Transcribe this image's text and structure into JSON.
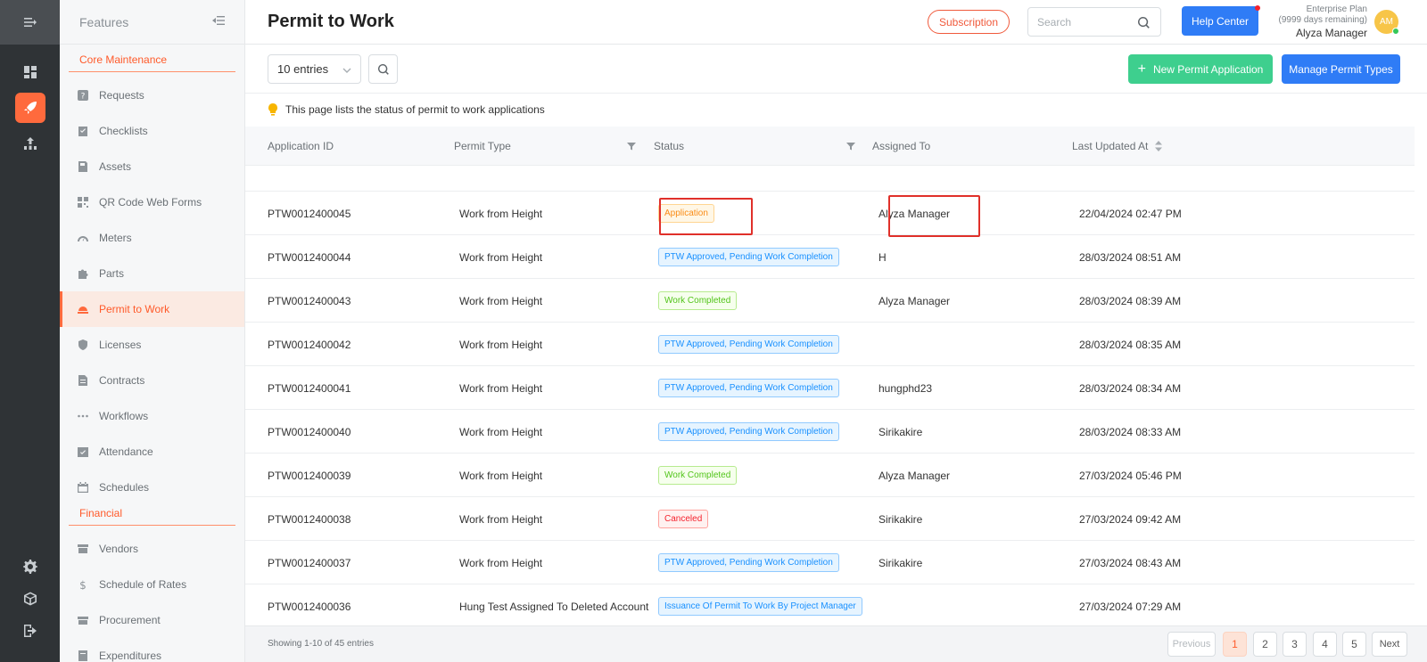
{
  "sidebar": {
    "title": "Features",
    "sections": [
      {
        "label": "Core Maintenance",
        "items": [
          {
            "label": "Requests",
            "icon": "question-icon"
          },
          {
            "label": "Checklists",
            "icon": "checklist-icon"
          },
          {
            "label": "Assets",
            "icon": "asset-icon"
          },
          {
            "label": "QR Code Web Forms",
            "icon": "qr-icon"
          },
          {
            "label": "Meters",
            "icon": "meter-icon"
          },
          {
            "label": "Parts",
            "icon": "puzzle-icon"
          },
          {
            "label": "Permit to Work",
            "icon": "hardhat-icon",
            "active": true
          },
          {
            "label": "Licenses",
            "icon": "shield-icon"
          },
          {
            "label": "Contracts",
            "icon": "contract-icon"
          },
          {
            "label": "Workflows",
            "icon": "dots-icon"
          },
          {
            "label": "Attendance",
            "icon": "attendance-icon"
          },
          {
            "label": "Schedules",
            "icon": "calendar-icon"
          }
        ]
      },
      {
        "label": "Financial",
        "items": [
          {
            "label": "Vendors",
            "icon": "store-icon"
          },
          {
            "label": "Schedule of Rates",
            "icon": "dollar-icon"
          },
          {
            "label": "Procurement",
            "icon": "procurement-icon"
          },
          {
            "label": "Expenditures",
            "icon": "expenditure-icon"
          }
        ]
      }
    ]
  },
  "header": {
    "title": "Permit to Work",
    "subscription_label": "Subscription",
    "search_placeholder": "Search",
    "help_label": "Help Center",
    "plan_name": "Enterprise Plan",
    "plan_days": "(9999 days remaining)",
    "user_name": "Alyza Manager",
    "avatar_initials": "AM"
  },
  "toolbar": {
    "entries_label": "10 entries",
    "new_label": "New Permit Application",
    "manage_label": "Manage Permit Types"
  },
  "info_text": "This page lists the status of permit to work applications",
  "table": {
    "columns": [
      "Application ID",
      "Permit Type",
      "Status",
      "Assigned To",
      "Last Updated At"
    ],
    "rows": [
      {
        "id": "PTW0012400045",
        "type": "Work from Height",
        "status": "Application",
        "status_color": "orange",
        "assigned": "Alyza Manager",
        "updated": "22/04/2024 02:47 PM"
      },
      {
        "id": "PTW0012400044",
        "type": "Work from Height",
        "status": "PTW Approved, Pending Work Completion",
        "status_color": "blue",
        "assigned": "H",
        "updated": "28/03/2024 08:51 AM"
      },
      {
        "id": "PTW0012400043",
        "type": "Work from Height",
        "status": "Work Completed",
        "status_color": "green",
        "assigned": "Alyza Manager",
        "updated": "28/03/2024 08:39 AM"
      },
      {
        "id": "PTW0012400042",
        "type": "Work from Height",
        "status": "PTW Approved, Pending Work Completion",
        "status_color": "blue",
        "assigned": "",
        "updated": "28/03/2024 08:35 AM"
      },
      {
        "id": "PTW0012400041",
        "type": "Work from Height",
        "status": "PTW Approved, Pending Work Completion",
        "status_color": "blue",
        "assigned": "hungphd23",
        "updated": "28/03/2024 08:34 AM"
      },
      {
        "id": "PTW0012400040",
        "type": "Work from Height",
        "status": "PTW Approved, Pending Work Completion",
        "status_color": "blue",
        "assigned": "Sirikakire",
        "updated": "28/03/2024 08:33 AM"
      },
      {
        "id": "PTW0012400039",
        "type": "Work from Height",
        "status": "Work Completed",
        "status_color": "green",
        "assigned": "Alyza Manager",
        "updated": "27/03/2024 05:46 PM"
      },
      {
        "id": "PTW0012400038",
        "type": "Work from Height",
        "status": "Canceled",
        "status_color": "red",
        "assigned": "Sirikakire",
        "updated": "27/03/2024 09:42 AM"
      },
      {
        "id": "PTW0012400037",
        "type": "Work from Height",
        "status": "PTW Approved, Pending Work Completion",
        "status_color": "blue",
        "assigned": "Sirikakire",
        "updated": "27/03/2024 08:43 AM"
      },
      {
        "id": "PTW0012400036",
        "type": "Hung Test Assigned To Deleted Account",
        "status": "Issuance Of Permit To Work By Project Manager",
        "status_color": "blue",
        "assigned": "",
        "updated": "27/03/2024 07:29 AM"
      }
    ]
  },
  "footer": {
    "showing": "Showing 1-10 of 45 entries",
    "prev": "Previous",
    "next": "Next",
    "pages": [
      "1",
      "2",
      "3",
      "4",
      "5"
    ],
    "current_page": "1"
  },
  "colors": {
    "accent": "#ff6a3d",
    "primary": "#2f7cf6",
    "success": "#3ecf8e",
    "highlight_box": "#e0302a"
  }
}
